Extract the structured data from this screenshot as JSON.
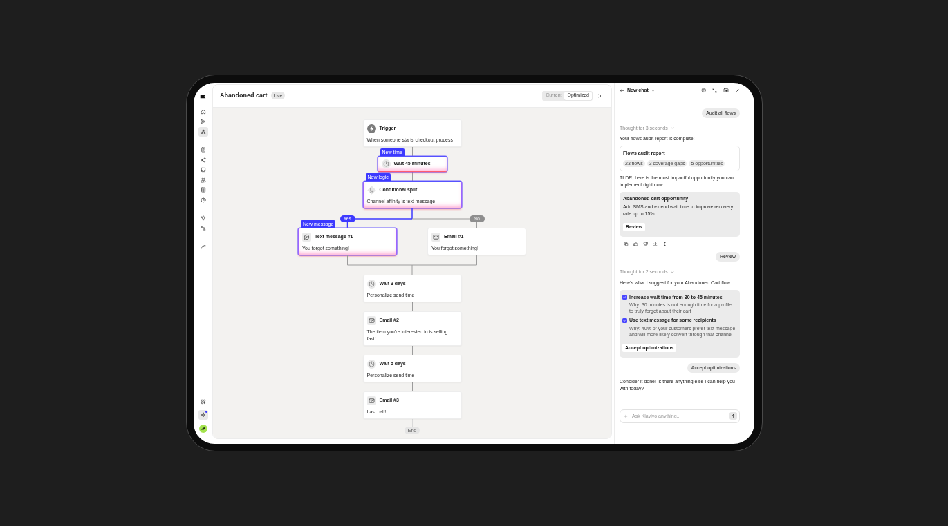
{
  "sidebar": {
    "groups": [
      {
        "items": [
          {
            "selected": false
          },
          {
            "selected": false
          },
          {
            "selected": true
          }
        ]
      },
      {
        "items": [
          {
            "selected": false
          },
          {
            "selected": false
          },
          {
            "selected": false
          },
          {
            "selected": false
          },
          {
            "selected": false
          },
          {
            "selected": false
          }
        ]
      },
      {
        "items": [
          {
            "selected": false
          },
          {
            "selected": false
          }
        ]
      },
      {
        "items": [
          {
            "selected": false
          }
        ]
      }
    ],
    "bottom": [
      {
        "selected": false,
        "notification": false
      },
      {
        "selected": true,
        "notification": true
      }
    ]
  },
  "header": {
    "title": "Abandoned cart",
    "status": "Live",
    "view_toggle": [
      {
        "label": "Current",
        "selected": false
      },
      {
        "label": "Optimized",
        "selected": true
      }
    ]
  },
  "flow": {
    "steps": [
      {
        "kind": "trigger",
        "title": "Trigger",
        "detail": "When someone starts checkout process",
        "highlighted": false
      },
      {
        "kind": "wait",
        "title": "Wait 45 minutes",
        "badge": "New time",
        "highlighted": true
      },
      {
        "kind": "split",
        "title": "Conditional split",
        "detail": "Channel affinity is text message",
        "badge": "New logic",
        "highlighted": true,
        "branches": [
          {
            "label": "Yes",
            "highlighted": true,
            "steps": [
              {
                "kind": "sms",
                "title": "Text message #1",
                "detail": "You forgot something!",
                "badge": "New message",
                "highlighted": true
              }
            ]
          },
          {
            "label": "No",
            "highlighted": false,
            "steps": [
              {
                "kind": "email",
                "title": "Email #1",
                "detail": "You forgot something!",
                "highlighted": false
              }
            ]
          }
        ]
      },
      {
        "kind": "wait",
        "title": "Wait 3 days",
        "detail": "Personalize send time",
        "highlighted": false
      },
      {
        "kind": "email",
        "title": "Email #2",
        "detail": "The item you're interested in is selling fast!",
        "highlighted": false
      },
      {
        "kind": "wait",
        "title": "Wait 5 days",
        "detail": "Personalize send time",
        "highlighted": false
      },
      {
        "kind": "email",
        "title": "Email #3",
        "detail": "Last call!",
        "highlighted": false
      }
    ],
    "end": "End"
  },
  "chat": {
    "title": "New chat",
    "messages": [
      {
        "kind": "user",
        "text": "Audit all flows"
      },
      {
        "kind": "thought",
        "text": "Thought for 3 seconds"
      },
      {
        "kind": "text",
        "text": "Your flows audit report is complete!"
      },
      {
        "kind": "report",
        "title": "Flows audit report",
        "chips": [
          "23 flows",
          "3 coverage gaps",
          "5 opportunities"
        ]
      },
      {
        "kind": "text",
        "text": "TLDR, here is the most impactful opportunity you can implement right now:"
      },
      {
        "kind": "opportunity",
        "title": "Abandoned cart opportunity",
        "body": "Add SMS and extend wait time to improve recovery rate up to 15%.",
        "button": "Review"
      },
      {
        "kind": "actions"
      },
      {
        "kind": "user",
        "text": "Review"
      },
      {
        "kind": "thought",
        "text": "Thought for 2 seconds"
      },
      {
        "kind": "text",
        "text": "Here's what I suggest for your Abandoned Cart flow:"
      },
      {
        "kind": "suggestions",
        "items": [
          {
            "title": "Increase wait time from 30 to 45 minutes",
            "reason": "Why: 30 minutes is not enough time for a profile to truly forget about their cart",
            "checked": true
          },
          {
            "title": "Use text message for some recipients",
            "reason": "Why: 40% of your customers prefer text message and will more likely convert through that channel",
            "checked": true
          }
        ],
        "button": "Accept optimizations"
      },
      {
        "kind": "user",
        "text": "Accept optimizations"
      },
      {
        "kind": "text",
        "text": "Consider it done! Is there anything else I can help you with today?"
      }
    ],
    "composer": {
      "placeholder": "Ask Klaviyo anything..."
    }
  }
}
